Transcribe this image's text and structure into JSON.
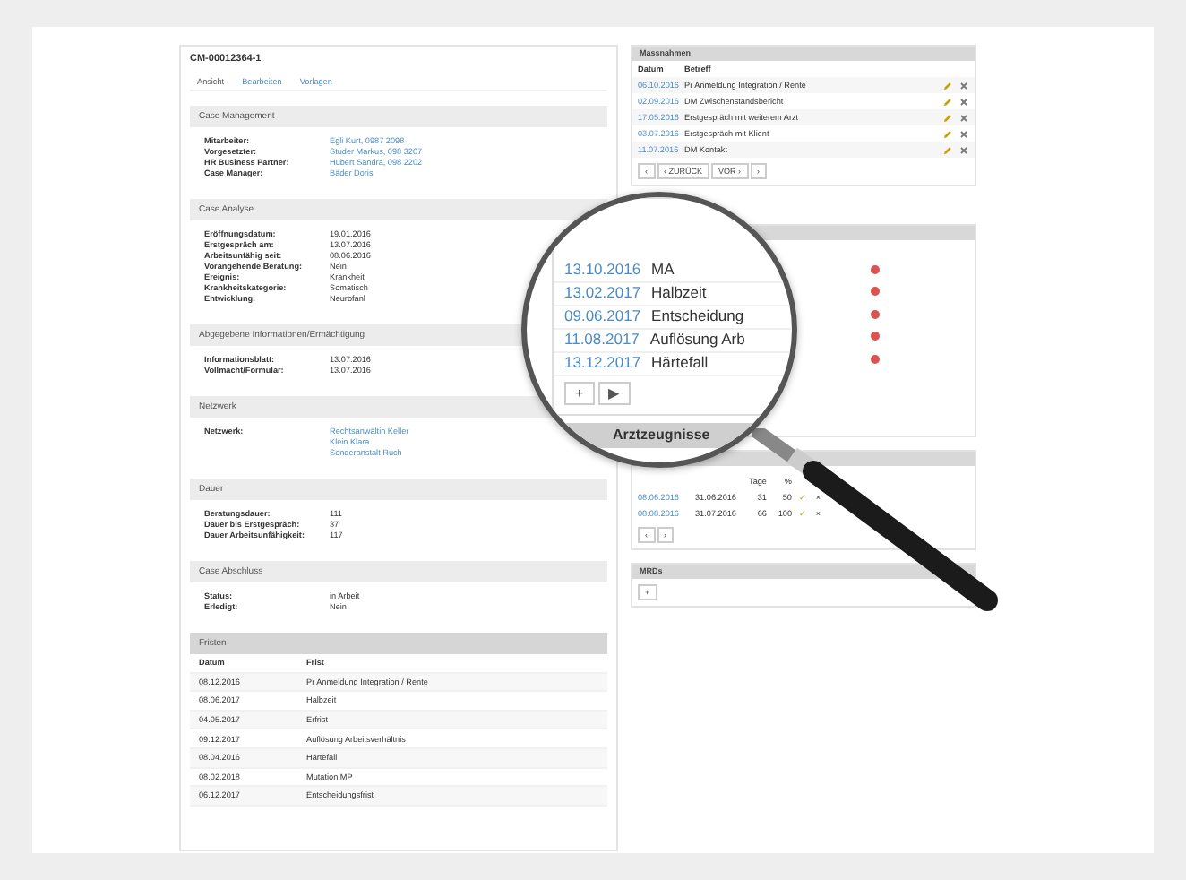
{
  "case_id": "CM-00012364-1",
  "tabs": [
    {
      "label": "Ansicht",
      "selected": true
    },
    {
      "label": "Bearbeiten",
      "selected": false
    },
    {
      "label": "Vorlagen",
      "selected": false
    }
  ],
  "sections": [
    {
      "title": "Case Management",
      "fields": [
        {
          "label": "Mitarbeiter:",
          "values": [
            "Egli Kurt, 0987 2098"
          ],
          "link": true
        },
        {
          "label": "Vorgesetzter:",
          "values": [
            "Studer Markus, 098 3207"
          ],
          "link": true
        },
        {
          "label": "HR Business Partner:",
          "values": [
            "Hubert Sandra, 098 2202"
          ],
          "link": true
        },
        {
          "label": "Case Manager:",
          "values": [
            "Bäder Doris"
          ],
          "link": true
        }
      ]
    },
    {
      "title": "Case Analyse",
      "fields": [
        {
          "label": "Eröffnungsdatum:",
          "values": [
            "19.01.2016"
          ],
          "link": false
        },
        {
          "label": "Erstgespräch am:",
          "values": [
            "13.07.2016"
          ],
          "link": false
        },
        {
          "label": "Arbeitsunfähig seit:",
          "values": [
            "08.06.2016"
          ],
          "link": false
        },
        {
          "label": "Vorangehende Beratung:",
          "values": [
            "Nein"
          ],
          "link": false
        },
        {
          "label": "Ereignis:",
          "values": [
            "Krankheit"
          ],
          "link": false
        },
        {
          "label": "Krankheitskategorie:",
          "values": [
            "Somatisch"
          ],
          "link": false
        },
        {
          "label": "Entwicklung:",
          "values": [
            "Neurofanl"
          ],
          "link": false
        }
      ]
    },
    {
      "title": "Abgegebene Informationen/Ermächtigung",
      "fields": [
        {
          "label": "Informationsblatt:",
          "values": [
            "13.07.2016"
          ],
          "link": false
        },
        {
          "label": "Vollmacht/Formular:",
          "values": [
            "13.07.2016"
          ],
          "link": false
        }
      ]
    },
    {
      "title": "Netzwerk",
      "fields": [
        {
          "label": "Netzwerk:",
          "values": [
            "Rechtsanwältin Keller",
            "Klein Klara",
            "Sonderanstalt Ruch"
          ],
          "link": true
        }
      ]
    },
    {
      "title": "Dauer",
      "fields": [
        {
          "label": "Beratungsdauer:",
          "values": [
            "111"
          ],
          "link": false
        },
        {
          "label": "Dauer bis Erstgespräch:",
          "values": [
            "37"
          ],
          "link": false
        },
        {
          "label": "Dauer Arbeitsunfähigkeit:",
          "values": [
            "117"
          ],
          "link": false
        }
      ]
    },
    {
      "title": "Case Abschluss",
      "fields": [
        {
          "label": "Status:",
          "values": [
            "in Arbeit"
          ],
          "link": false
        },
        {
          "label": "Erledigt:",
          "values": [
            "Nein"
          ],
          "link": false
        }
      ]
    }
  ],
  "fristen": {
    "title": "Fristen",
    "columns": [
      "Datum",
      "Frist"
    ],
    "rows": [
      [
        "08.12.2016",
        "Pr Anmeldung Integration / Rente"
      ],
      [
        "08.06.2017",
        "Halbzeit"
      ],
      [
        "04.05.2017",
        "Erfrist"
      ],
      [
        "09.12.2017",
        "Auflösung Arbeitsverhältnis"
      ],
      [
        "08.04.2016",
        "Härtefall"
      ],
      [
        "08.02.2018",
        "Mutation MP"
      ],
      [
        "06.12.2017",
        "Entscheidungsfrist"
      ]
    ]
  },
  "massnahmen": {
    "title": "Massnahmen",
    "columns": [
      "Datum",
      "Betreff"
    ],
    "rows": [
      [
        "06.10.2016",
        "Pr Anmeldung Integration / Rente"
      ],
      [
        "02.09.2016",
        "DM Zwischenstandsbericht"
      ],
      [
        "17.05.2016",
        "Erstgespräch mit weiterem Arzt"
      ],
      [
        "03.07.2016",
        "Erstgespräch mit Klient"
      ],
      [
        "11.07.2016",
        "DM Kontakt"
      ]
    ],
    "pager": [
      "‹",
      "‹ ZURÜCK",
      "VOR ›",
      "›"
    ]
  },
  "termine": {
    "rows": [
      {
        "date": "13.10.2016",
        "text": "MA"
      },
      {
        "date": "13.02.2017",
        "text": "Halbzeit"
      },
      {
        "date": "09.06.2017",
        "text": "Entscheidung"
      },
      {
        "date": "11.08.2017",
        "text": "Auflösung Arb"
      },
      {
        "date": "13.12.2017",
        "text": "Härtefall"
      }
    ],
    "buttons": [
      "+",
      "▶"
    ]
  },
  "arztzeugnisse": {
    "title": "Arztzeugnisse",
    "columns": [
      "",
      "",
      "Tage",
      "%",
      "",
      ""
    ],
    "rows": [
      [
        "08.06.2016",
        "31.06.2016",
        "31",
        "50",
        "✓",
        "×"
      ],
      [
        "08.08.2016",
        "31.07.2016",
        "66",
        "100",
        "✓",
        "×"
      ]
    ],
    "pager": [
      "‹",
      "›"
    ]
  },
  "mrds": {
    "title": "MRDs",
    "buttons": [
      "+"
    ]
  }
}
